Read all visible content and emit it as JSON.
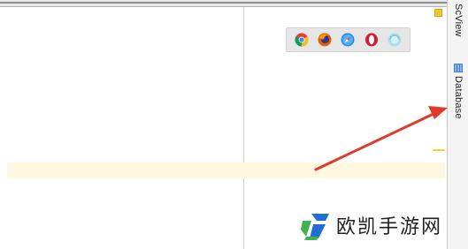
{
  "side_panel": {
    "tabs": [
      {
        "label": "ScView",
        "icon": "scview-icon"
      },
      {
        "label": "Database",
        "icon": "database-icon"
      }
    ]
  },
  "browser_bar": {
    "icons": [
      "chrome-icon",
      "firefox-icon",
      "safari-icon",
      "opera-icon",
      "browser-icon"
    ]
  },
  "watermark": {
    "text": "欧凯手游网",
    "icon": "watermark-logo-icon"
  },
  "colors": {
    "highlight_row": "#fdf8df",
    "arrow": "#e0392d",
    "accent_yellow": "#f3c532",
    "logo_green": "#3fb34f",
    "logo_blue": "#1f6fd1"
  }
}
